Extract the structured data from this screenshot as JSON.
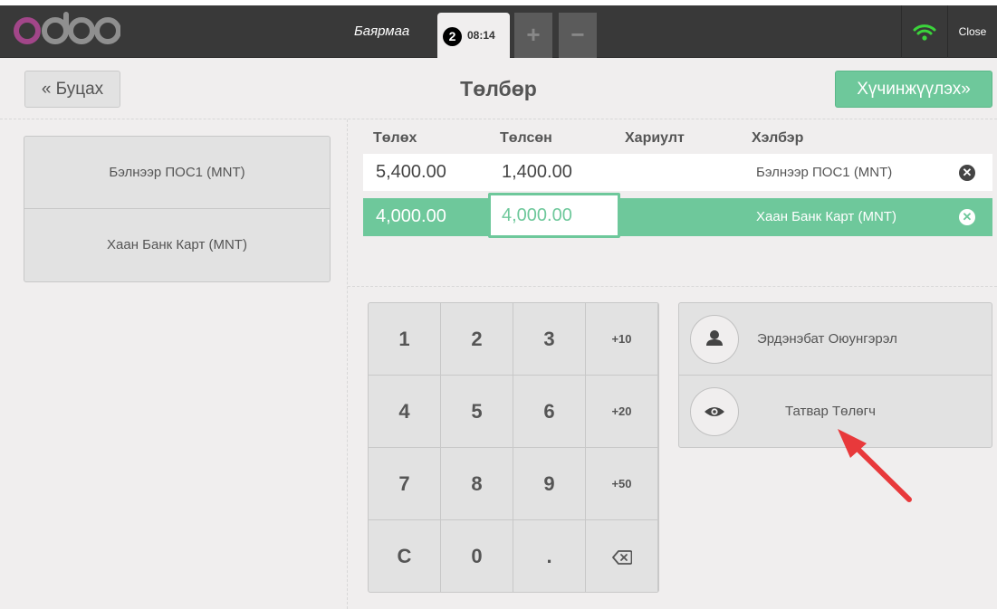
{
  "header": {
    "cashier": "Баярмаа",
    "order_number": "2",
    "order_time": "08:14",
    "add_order": "+",
    "remove_order": "−",
    "close_label": "Close"
  },
  "topbar": {
    "back_label": "« Буцах",
    "title": "Төлбөр",
    "validate_label": "Хүчинжүүлэх»"
  },
  "payment_methods": [
    "Бэлнээр ПОС1 (MNT)",
    "Хаан Банк Карт (MNT)"
  ],
  "paymentlines": {
    "headers": [
      "Төлөх",
      "Төлсөн",
      "Хариулт",
      "Хэлбэр"
    ],
    "rows": [
      {
        "due": "5,400.00",
        "tendered": "1,400.00",
        "change": "",
        "method": "Бэлнээр ПОС1 (MNT)"
      },
      {
        "due": "4,000.00",
        "tendered": "4,000.00",
        "change": "",
        "method": "Хаан Банк Карт (MNT)"
      }
    ]
  },
  "numpad": {
    "keys": [
      "1",
      "2",
      "3",
      "+10",
      "4",
      "5",
      "6",
      "+20",
      "7",
      "8",
      "9",
      "+50",
      "C",
      "0",
      ".",
      "⌫"
    ]
  },
  "extras": {
    "customer": "Эрдэнэбат Оюунгэрэл",
    "tax_payer": "Татвар Төлөгч"
  },
  "colors": {
    "header_bg": "#393939",
    "accent_green": "#6ec89b",
    "logo_purple": "#a24689",
    "arrow_red": "#e8393b"
  },
  "icons": {
    "wifi": "wifi-icon",
    "customer": "user-icon",
    "tax": "eye-icon",
    "delete": "times-circle-icon",
    "backspace": "backspace-icon"
  }
}
